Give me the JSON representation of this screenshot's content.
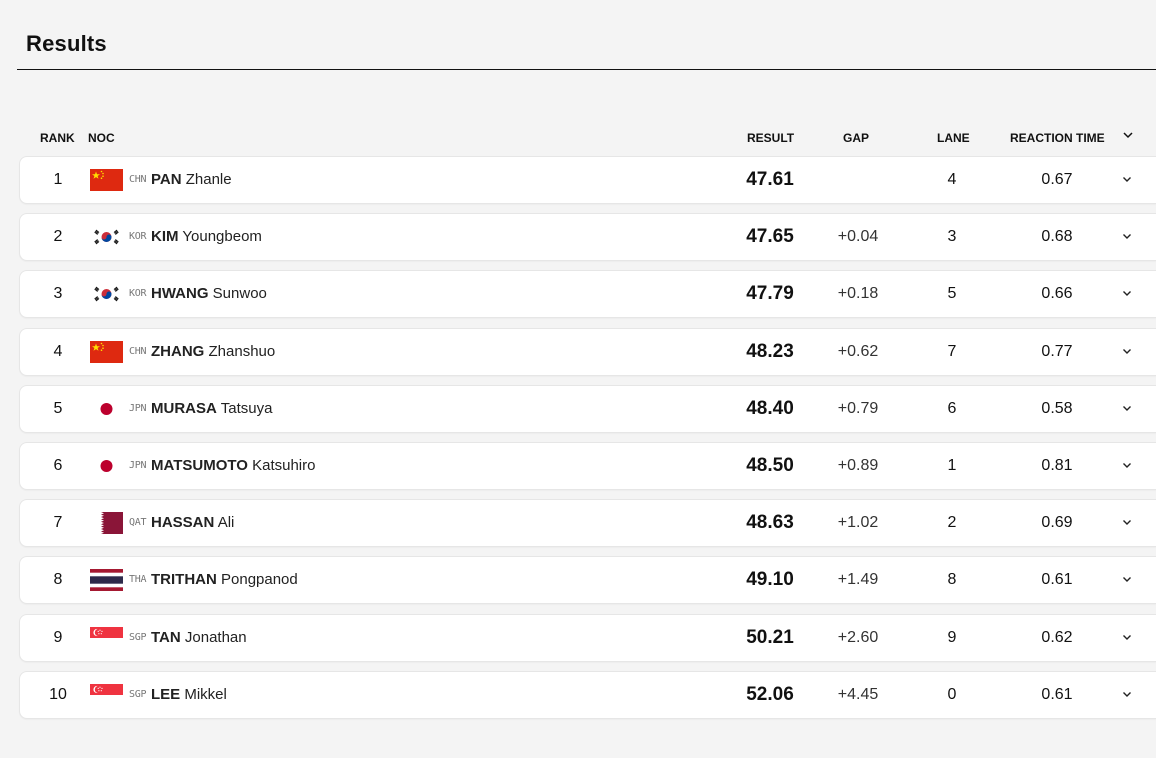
{
  "title": "Results",
  "headers": {
    "rank": "RANK",
    "noc": "NOC",
    "result": "RESULT",
    "gap": "GAP",
    "lane": "LANE",
    "reaction": "REACTION TIME"
  },
  "rows": [
    {
      "rank": "1",
      "flag": "CHN",
      "code": "CHN",
      "last": "PAN",
      "first": "Zhanle",
      "result": "47.61",
      "gap": "",
      "lane": "4",
      "reaction": "0.67"
    },
    {
      "rank": "2",
      "flag": "KOR",
      "code": "KOR",
      "last": "KIM",
      "first": "Youngbeom",
      "result": "47.65",
      "gap": "+0.04",
      "lane": "3",
      "reaction": "0.68"
    },
    {
      "rank": "3",
      "flag": "KOR",
      "code": "KOR",
      "last": "HWANG",
      "first": "Sunwoo",
      "result": "47.79",
      "gap": "+0.18",
      "lane": "5",
      "reaction": "0.66"
    },
    {
      "rank": "4",
      "flag": "CHN",
      "code": "CHN",
      "last": "ZHANG",
      "first": "Zhanshuo",
      "result": "48.23",
      "gap": "+0.62",
      "lane": "7",
      "reaction": "0.77"
    },
    {
      "rank": "5",
      "flag": "JPN",
      "code": "JPN",
      "last": "MURASA",
      "first": "Tatsuya",
      "result": "48.40",
      "gap": "+0.79",
      "lane": "6",
      "reaction": "0.58"
    },
    {
      "rank": "6",
      "flag": "JPN",
      "code": "JPN",
      "last": "MATSUMOTO",
      "first": "Katsuhiro",
      "result": "48.50",
      "gap": "+0.89",
      "lane": "1",
      "reaction": "0.81"
    },
    {
      "rank": "7",
      "flag": "QAT",
      "code": "QAT",
      "last": "HASSAN",
      "first": "Ali",
      "result": "48.63",
      "gap": "+1.02",
      "lane": "2",
      "reaction": "0.69"
    },
    {
      "rank": "8",
      "flag": "THA",
      "code": "THA",
      "last": "TRITHAN",
      "first": "Pongpanod",
      "result": "49.10",
      "gap": "+1.49",
      "lane": "8",
      "reaction": "0.61"
    },
    {
      "rank": "9",
      "flag": "SGP",
      "code": "SGP",
      "last": "TAN",
      "first": "Jonathan",
      "result": "50.21",
      "gap": "+2.60",
      "lane": "9",
      "reaction": "0.62"
    },
    {
      "rank": "10",
      "flag": "SGP",
      "code": "SGP",
      "last": "LEE",
      "first": "Mikkel",
      "result": "52.06",
      "gap": "+4.45",
      "lane": "0",
      "reaction": "0.61"
    }
  ],
  "colors": {
    "china_red": "#de2910",
    "china_yellow": "#ffde00",
    "japan_red": "#bc002d",
    "qatar_maroon": "#8a1538",
    "thai_red": "#a51931",
    "thai_blue": "#2d2a4a",
    "singapore_red": "#ef3340",
    "korea_red": "#cd2e3a",
    "korea_blue": "#0047a0"
  }
}
